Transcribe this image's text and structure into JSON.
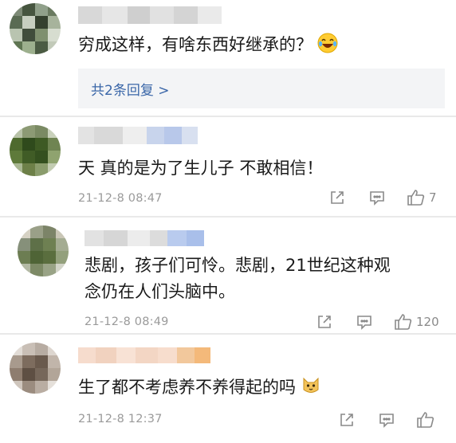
{
  "comments": [
    {
      "text": "穷成这样，有啥东西好继承的？",
      "emoji_icon": "laughing-tears-emoji",
      "reply_summary": "共2条回复 >"
    },
    {
      "text": "天 真的是为了生儿子 不敢相信！",
      "time": "21-12-8 08:47",
      "likes": "7",
      "icons": [
        "share-icon",
        "comment-icon",
        "thumbs-up-icon"
      ]
    },
    {
      "text_line1": "悲剧，孩子们可怜。悲剧，21世纪这种观",
      "text_line2": "念仍在人们头脑中。",
      "time": "21-12-8 08:49",
      "likes": "120",
      "icons": [
        "share-icon",
        "comment-icon",
        "thumbs-up-icon"
      ]
    },
    {
      "text": "生了都不考虑养不养得起的吗",
      "emoji_icon": "cat-emoji",
      "time": "21-12-8 12:37",
      "icons": [
        "share-icon",
        "comment-icon",
        "thumbs-up-icon"
      ]
    }
  ],
  "colors": {
    "link": "#3a66a8",
    "meta": "#9a9a9a",
    "reply_bg": "#f3f4f6",
    "separator": "#e9e9e9"
  }
}
